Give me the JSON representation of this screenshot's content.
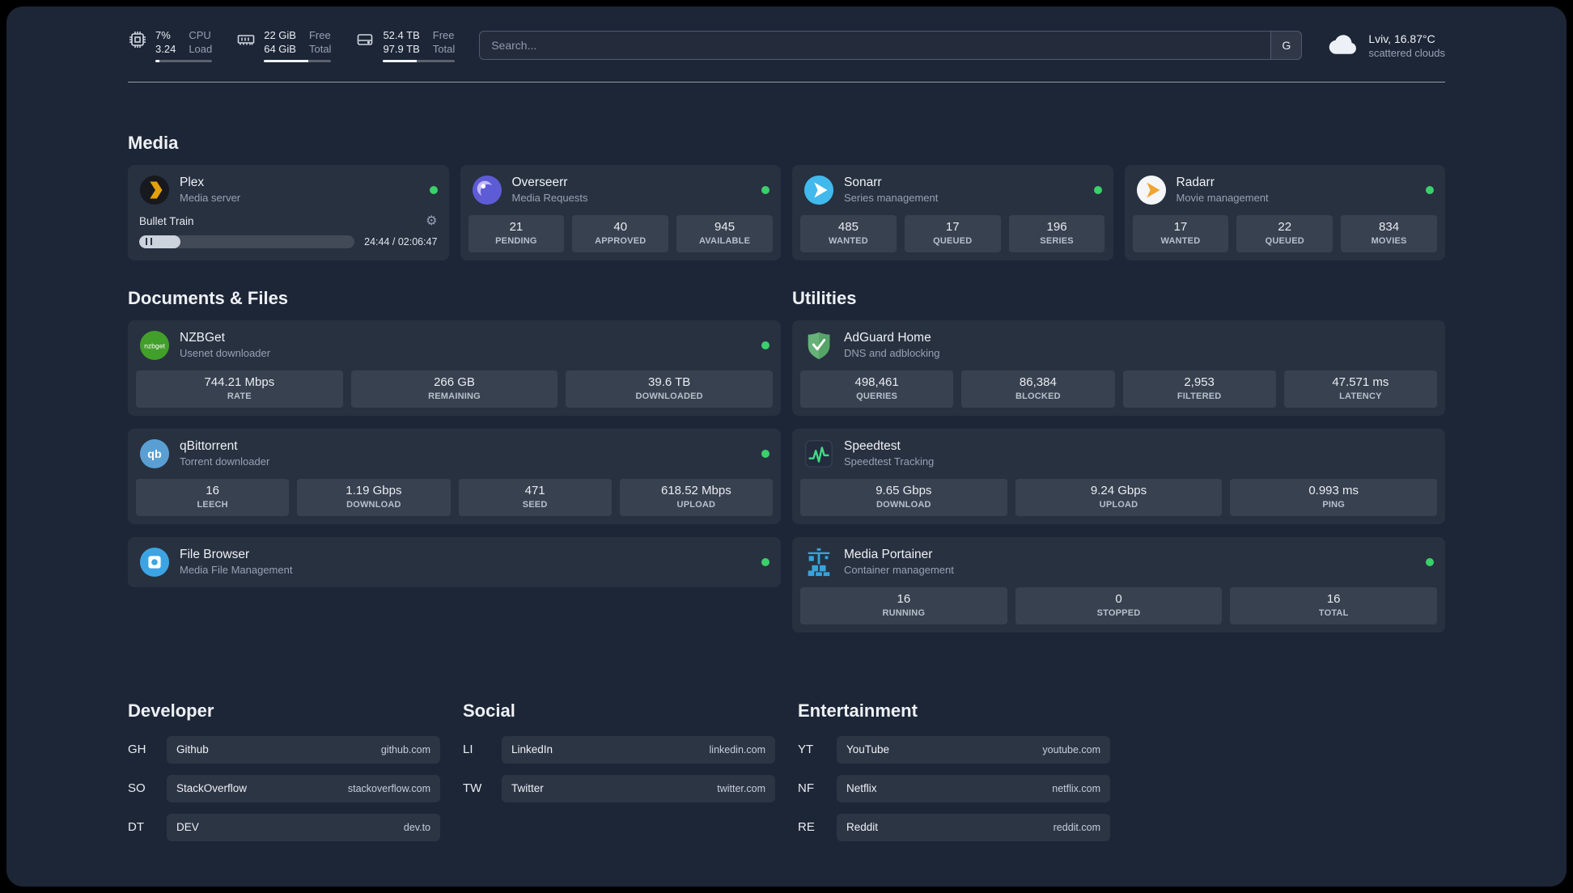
{
  "colors": {
    "page_background": "#1d2636",
    "status_online": "#3ad06a",
    "plex_accent": "#e5a00d",
    "overseerr_accent": "#5d5bd5",
    "sonarr_accent": "#41b9ec",
    "radarr_accent": "#f0a431",
    "nzbget_accent": "#42a02a",
    "qbittorrent_accent": "#5a9fd4",
    "filebrowser_accent": "#3da4e3",
    "adguard_accent": "#67b279",
    "speedtest_accent": "#3ddc84",
    "portainer_accent": "#3aa2db"
  },
  "header": {
    "cpu": {
      "icon": "cpu-chip-icon",
      "value_top": "7%",
      "value_bottom": "3.24",
      "label_top": "CPU",
      "label_bottom": "Load",
      "progress": 7
    },
    "memory": {
      "icon": "memory-icon",
      "value_top": "22 GiB",
      "value_bottom": "64 GiB",
      "label_top": "Free",
      "label_bottom": "Total",
      "progress": 66
    },
    "disk": {
      "icon": "disk-icon",
      "value_top": "52.4 TB",
      "value_bottom": "97.9 TB",
      "label_top": "Free",
      "label_bottom": "Total",
      "progress": 47
    },
    "search": {
      "placeholder": "Search...",
      "provider_label": "G"
    },
    "weather": {
      "icon": "cloud-icon",
      "location": "Lviv, 16.87°C",
      "condition": "scattered clouds"
    }
  },
  "sections": {
    "media": {
      "title": "Media",
      "cards": {
        "plex": {
          "title": "Plex",
          "subtitle": "Media server",
          "icon": "plex-icon",
          "status": "online",
          "player": {
            "track": "Bullet Train",
            "time": "24:44 / 02:06:47",
            "progress": 19
          }
        },
        "overseerr": {
          "title": "Overseerr",
          "subtitle": "Media Requests",
          "icon": "overseerr-icon",
          "status": "online",
          "stats": [
            {
              "value": "21",
              "label": "PENDING"
            },
            {
              "value": "40",
              "label": "APPROVED"
            },
            {
              "value": "945",
              "label": "AVAILABLE"
            }
          ]
        },
        "sonarr": {
          "title": "Sonarr",
          "subtitle": "Series management",
          "icon": "sonarr-icon",
          "status": "online",
          "stats": [
            {
              "value": "485",
              "label": "WANTED"
            },
            {
              "value": "17",
              "label": "QUEUED"
            },
            {
              "value": "196",
              "label": "SERIES"
            }
          ]
        },
        "radarr": {
          "title": "Radarr",
          "subtitle": "Movie management",
          "icon": "radarr-icon",
          "status": "online",
          "stats": [
            {
              "value": "17",
              "label": "WANTED"
            },
            {
              "value": "22",
              "label": "QUEUED"
            },
            {
              "value": "834",
              "label": "MOVIES"
            }
          ]
        }
      }
    },
    "documents": {
      "title": "Documents & Files",
      "cards": {
        "nzbget": {
          "title": "NZBGet",
          "subtitle": "Usenet downloader",
          "icon": "nzbget-icon",
          "status": "online",
          "stats": [
            {
              "value": "744.21 Mbps",
              "label": "RATE"
            },
            {
              "value": "266 GB",
              "label": "REMAINING"
            },
            {
              "value": "39.6 TB",
              "label": "DOWNLOADED"
            }
          ]
        },
        "qbittorrent": {
          "title": "qBittorrent",
          "subtitle": "Torrent downloader",
          "icon": "qbittorrent-icon",
          "status": "online",
          "stats": [
            {
              "value": "16",
              "label": "LEECH"
            },
            {
              "value": "1.19 Gbps",
              "label": "DOWNLOAD"
            },
            {
              "value": "471",
              "label": "SEED"
            },
            {
              "value": "618.52 Mbps",
              "label": "UPLOAD"
            }
          ]
        },
        "filebrowser": {
          "title": "File Browser",
          "subtitle": "Media File Management",
          "icon": "filebrowser-icon",
          "status": "online"
        }
      }
    },
    "utilities": {
      "title": "Utilities",
      "cards": {
        "adguard": {
          "title": "AdGuard Home",
          "subtitle": "DNS and adblocking",
          "icon": "adguard-icon",
          "stats": [
            {
              "value": "498,461",
              "label": "QUERIES"
            },
            {
              "value": "86,384",
              "label": "BLOCKED"
            },
            {
              "value": "2,953",
              "label": "FILTERED"
            },
            {
              "value": "47.571 ms",
              "label": "LATENCY"
            }
          ]
        },
        "speedtest": {
          "title": "Speedtest",
          "subtitle": "Speedtest Tracking",
          "icon": "speedtest-icon",
          "stats": [
            {
              "value": "9.65 Gbps",
              "label": "DOWNLOAD"
            },
            {
              "value": "9.24 Gbps",
              "label": "UPLOAD"
            },
            {
              "value": "0.993 ms",
              "label": "PING"
            }
          ]
        },
        "portainer": {
          "title": "Media Portainer",
          "subtitle": "Container management",
          "icon": "portainer-icon",
          "status": "online",
          "stats": [
            {
              "value": "16",
              "label": "RUNNING"
            },
            {
              "value": "0",
              "label": "STOPPED"
            },
            {
              "value": "16",
              "label": "TOTAL"
            }
          ]
        }
      }
    }
  },
  "bookmarks": {
    "groups": [
      {
        "title": "Developer",
        "items": [
          {
            "abbr": "GH",
            "name": "Github",
            "url": "github.com"
          },
          {
            "abbr": "SO",
            "name": "StackOverflow",
            "url": "stackoverflow.com"
          },
          {
            "abbr": "DT",
            "name": "DEV",
            "url": "dev.to"
          }
        ]
      },
      {
        "title": "Social",
        "items": [
          {
            "abbr": "LI",
            "name": "LinkedIn",
            "url": "linkedin.com"
          },
          {
            "abbr": "TW",
            "name": "Twitter",
            "url": "twitter.com"
          }
        ]
      },
      {
        "title": "Entertainment",
        "items": [
          {
            "abbr": "YT",
            "name": "YouTube",
            "url": "youtube.com"
          },
          {
            "abbr": "NF",
            "name": "Netflix",
            "url": "netflix.com"
          },
          {
            "abbr": "RE",
            "name": "Reddit",
            "url": "reddit.com"
          }
        ]
      }
    ]
  }
}
